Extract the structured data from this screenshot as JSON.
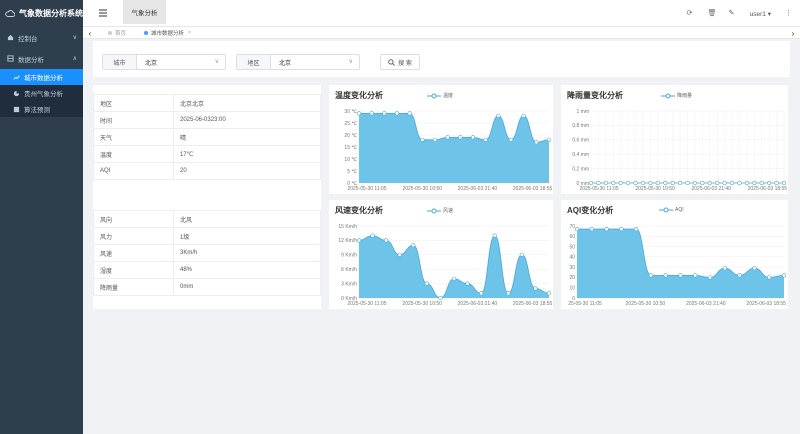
{
  "app": {
    "title": "气象数据分析系统"
  },
  "sidebar": {
    "items": [
      {
        "label": "控制台"
      },
      {
        "label": "数据分析"
      }
    ],
    "subitems": [
      {
        "label": "城市数据分析"
      },
      {
        "label": "贵州气象分析"
      },
      {
        "label": "算法预测"
      }
    ]
  },
  "navbar": {
    "tab": "气象分析",
    "user": "user1"
  },
  "tags": {
    "home": "首页",
    "current": "城市数据分析"
  },
  "search": {
    "city_label": "城市",
    "city_value": "北京",
    "region_label": "地区",
    "region_value": "北京",
    "button": "搜 索"
  },
  "info1": {
    "rows": [
      {
        "k": "地区",
        "v": "北京北京"
      },
      {
        "k": "时间",
        "v": "2025-06-0323:00"
      },
      {
        "k": "天气",
        "v": "晴"
      },
      {
        "k": "温度",
        "v": "17℃"
      },
      {
        "k": "AQI",
        "v": "20"
      }
    ]
  },
  "info2": {
    "rows": [
      {
        "k": "风向",
        "v": "北风"
      },
      {
        "k": "风力",
        "v": "1级"
      },
      {
        "k": "风速",
        "v": "3Km/h"
      },
      {
        "k": "湿度",
        "v": "48%"
      },
      {
        "k": "降雨量",
        "v": "0mm"
      }
    ]
  },
  "colors": {
    "area": "#6ec3e8",
    "line": "#4aa8d8",
    "accent": "#1890ff"
  },
  "chart_data": [
    {
      "type": "area",
      "title": "温度变化分析",
      "series_name": "温度",
      "x_ticks": [
        "2025-05-30 11:05",
        "2025-05-30 10:50",
        "2025-06-03 21:40",
        "2025-06-03 18:55"
      ],
      "y_ticks": [
        "0 ℃",
        "5 ℃",
        "10 ℃",
        "15 ℃",
        "20 ℃",
        "25 ℃",
        "30 ℃"
      ],
      "ylim": [
        0,
        30
      ],
      "values": [
        29,
        29,
        29,
        29,
        29,
        18,
        18,
        19,
        19,
        19,
        18,
        28,
        18,
        28,
        17,
        18
      ]
    },
    {
      "type": "line",
      "title": "降雨量变化分析",
      "series_name": "降雨量",
      "x_ticks": [
        "2025-05-30 11:05",
        "2025-05-30 10:50",
        "2025-06-03 21:40",
        "2025-06-03 18:55"
      ],
      "y_ticks": [
        "0 mm",
        "0.2 mm",
        "0.4 mm",
        "0.6 mm",
        "0.8 mm",
        "1 mm"
      ],
      "ylim": [
        0,
        1
      ],
      "values": [
        0,
        0,
        0,
        0,
        0,
        0,
        0,
        0,
        0,
        0,
        0,
        0,
        0,
        0,
        0,
        0,
        0,
        0,
        0,
        0,
        0,
        0,
        0,
        0,
        0,
        0,
        0
      ]
    },
    {
      "type": "area",
      "title": "风速变化分析",
      "series_name": "风速",
      "x_ticks": [
        "2025-05-30 11:05",
        "2025-05-30 10:50",
        "2025-06-03 21:40",
        "2025-06-03 18:55"
      ],
      "y_ticks": [
        "0 Km/h",
        "3 Km/h",
        "6 Km/h",
        "9 Km/h",
        "12 Km/h",
        "15 Km/h"
      ],
      "ylim": [
        0,
        15
      ],
      "values": [
        12,
        13,
        12,
        9,
        11,
        3,
        0,
        4,
        3,
        1,
        13,
        1,
        9,
        2,
        1
      ]
    },
    {
      "type": "area",
      "title": "AQI变化分析",
      "series_name": "AQI",
      "x_ticks": [
        "25-05-30 11:05",
        "2025-05-30 10:50",
        "2025-06-03 21:40",
        "2025-06-03 18:55"
      ],
      "y_ticks": [
        "0",
        "10",
        "20",
        "30",
        "40",
        "50",
        "60",
        "70"
      ],
      "ylim": [
        0,
        70
      ],
      "values": [
        67,
        67,
        67,
        67,
        67,
        22,
        22,
        22,
        22,
        20,
        29,
        22,
        29,
        20,
        22
      ]
    }
  ]
}
